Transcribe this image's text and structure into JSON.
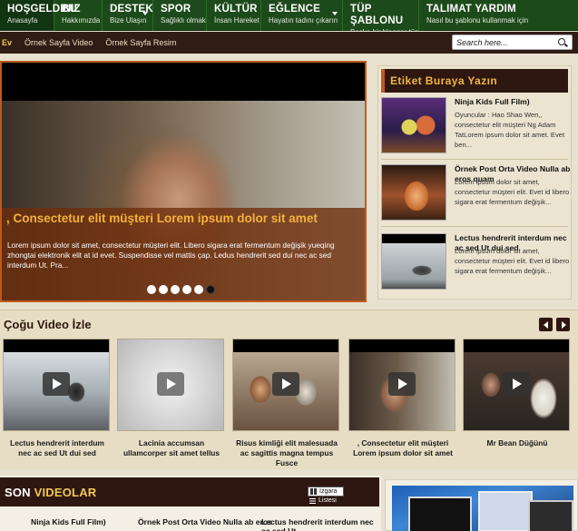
{
  "nav": [
    {
      "title": "HOŞGELDINIZ",
      "sub": "Anasayfa",
      "active": true,
      "caret": false
    },
    {
      "title": "BU",
      "sub": "Hakkımızda",
      "active": false,
      "caret": false
    },
    {
      "title": "DESTEK",
      "sub": "Bize Ulaşın",
      "active": false,
      "caret": true
    },
    {
      "title": "SPOR",
      "sub": "Sağlıklı olmak",
      "active": false,
      "caret": false
    },
    {
      "title": "KÜLTÜR",
      "sub": "İnsan Hareket",
      "active": false,
      "caret": false
    },
    {
      "title": "EĞLENCE",
      "sub": "Hayatın tadını çıkarın",
      "active": false,
      "caret": true
    },
    {
      "title": "TÜP ŞABLONU",
      "sub": "Başka bir blogger tüp",
      "active": false,
      "caret": false
    },
    {
      "title": "TALIMAT YARDIM",
      "sub": "Nasıl bu şablonu kullanmak için",
      "active": false,
      "caret": false
    }
  ],
  "subnav": {
    "home": "Ev",
    "links": [
      "Örnek Sayfa Video",
      "Örnek Sayfa Resim"
    ]
  },
  "search": {
    "placeholder": "Search here..."
  },
  "slider": {
    "title": ", Consectetur elit müşteri Lorem ipsum dolor sit amet",
    "text": "Lorem ipsum dolor sit amet, consectetur müşteri elit. Libero sigara erat fermentum değişik yueqing zhongtai elektronik elit at id evet. Suspendisse vel mattis çap. Ledus hendrerit sed dui nec ac sed interdum Ut. Pra...",
    "dots": 6,
    "active_dot": 5
  },
  "tag_panel": {
    "title": "Etiket Buraya Yazın",
    "items": [
      {
        "title": "Ninja Kids Full Film)",
        "desc": "Oyuncular : Hao Shao Wen,, consectetur elit müşteri Ng Adam TatLorem ipsum dolor sit amet. Evet ben..."
      },
      {
        "title": "Örnek Post Orta Video Nulla ab eros quam",
        "desc": "Lorem ipsum dolor sit amet, consectetur müşteri elit. Evet id libero sigara erat fermentum değişik..."
      },
      {
        "title": "Lectus hendrerit interdum nec ac sed Ut dui sed",
        "desc": "Lorem ipsum dolor sit amet, consectetur müşteri elit. Evet id libero sigara erat fermentum değişik..."
      }
    ]
  },
  "most_watched": {
    "title": "Çoğu Video İzle",
    "items": [
      {
        "caption": "Lectus hendrerit interdum nec ac sed Ut dui sed"
      },
      {
        "caption": "Lacinia accumsan ullamcorper sit amet tellus"
      },
      {
        "caption": "Risus kimliği elit malesuada ac sagittis magna tempus Fusce"
      },
      {
        "caption": ", Consectetur elit müşteri Lorem ipsum dolor sit amet"
      },
      {
        "caption": "Mr Bean Düğünü"
      }
    ]
  },
  "latest": {
    "title_a": "SON ",
    "title_b": "VIDEOLAR",
    "grid_label": "Izgara",
    "list_label": "Listesi",
    "items": [
      "Ninja Kids Full Film)",
      "Örnek Post Orta Video Nulla ab eros",
      "Lectus hendrerit interdum nec ac sed Ut"
    ]
  },
  "colors": {
    "nav_green": "#1d4a1a",
    "dark_brown": "#2e1710",
    "accent_orange": "#c05a1a",
    "gold": "#f0b640"
  }
}
